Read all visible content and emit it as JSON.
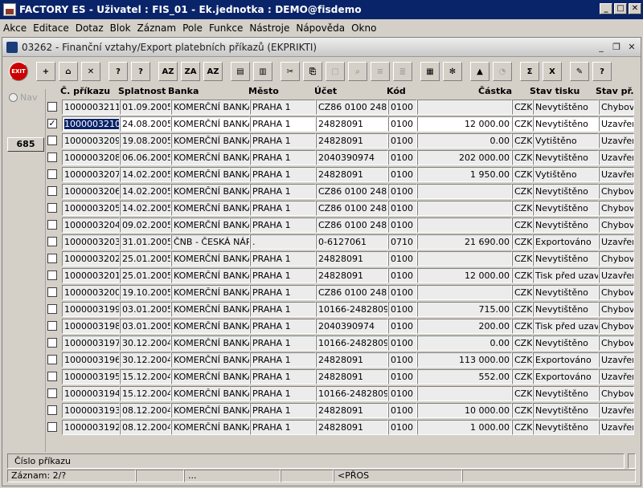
{
  "window": {
    "title": "FACTORY ES - Uživatel : FIS_01 - Ek.jednotka : DEMO@fisdemo"
  },
  "menu": [
    "Akce",
    "Editace",
    "Dotaz",
    "Blok",
    "Záznam",
    "Pole",
    "Funkce",
    "Nástroje",
    "Nápověda",
    "Okno"
  ],
  "form": {
    "title": "03262 - Finanční vztahy/Export platebních příkazů (EKPRIKTI)"
  },
  "toolbar": [
    {
      "name": "exit-button",
      "label": "EXIT",
      "enabled": true
    },
    {
      "name": "insert-record-button",
      "label": "+",
      "enabled": true
    },
    {
      "name": "save-button",
      "label": "⌂",
      "enabled": true
    },
    {
      "name": "delete-record-button",
      "label": "✕",
      "enabled": true
    },
    {
      "name": "query-button",
      "label": "?",
      "enabled": true
    },
    {
      "name": "execute-query-button",
      "label": "?",
      "enabled": true
    },
    {
      "name": "sort-asc-button",
      "label": "AZ",
      "enabled": true
    },
    {
      "name": "sort-desc-button",
      "label": "ZA",
      "enabled": true
    },
    {
      "name": "sort-multi-button",
      "label": "AZ",
      "enabled": true
    },
    {
      "name": "print-button",
      "label": "▤",
      "enabled": true
    },
    {
      "name": "print-preview-button",
      "label": "▥",
      "enabled": true
    },
    {
      "name": "cut-button",
      "label": "✂",
      "enabled": true
    },
    {
      "name": "copy-button",
      "label": "⎘",
      "enabled": true
    },
    {
      "name": "paste-button",
      "label": "▢",
      "enabled": false
    },
    {
      "name": "find-button",
      "label": "⌕",
      "enabled": false
    },
    {
      "name": "list-button",
      "label": "≡",
      "enabled": false
    },
    {
      "name": "list2-button",
      "label": "≣",
      "enabled": false
    },
    {
      "name": "calculator-button",
      "label": "▦",
      "enabled": true
    },
    {
      "name": "settings-button",
      "label": "✻",
      "enabled": true
    },
    {
      "name": "triangle-button",
      "label": "▲",
      "enabled": true
    },
    {
      "name": "calendar-button",
      "label": "◔",
      "enabled": false
    },
    {
      "name": "sum-button",
      "label": "Σ",
      "enabled": true
    },
    {
      "name": "excel-button",
      "label": "X",
      "enabled": true
    },
    {
      "name": "edit-form-button",
      "label": "✎",
      "enabled": true
    },
    {
      "name": "help-button",
      "label": "?",
      "enabled": true
    }
  ],
  "nav": {
    "label": "Nav",
    "count": "685"
  },
  "columns": [
    "Č. příkazu",
    "Splatnost",
    "Banka",
    "Město",
    "Účet",
    "Kód",
    "Částka",
    "Stav tisku",
    "Stav př."
  ],
  "rows": [
    {
      "checked": false,
      "cislo": "1000003211",
      "splatnost": "01.09.2005",
      "banka": "KOMERČNÍ BANKA",
      "mesto": "PRAHA 1",
      "ucet": "CZ86 0100 2482 0",
      "kod": "0100",
      "castka": "",
      "mena": "CZK",
      "stav_tisku": "Nevytištěno",
      "stav_pr": "Chybový"
    },
    {
      "checked": true,
      "cislo": "1000003210",
      "splatnost": "24.08.2005",
      "banka": "KOMERČNÍ BANKA",
      "mesto": "PRAHA 1",
      "ucet": "24828091",
      "kod": "0100",
      "castka": "12 000.00",
      "mena": "CZK",
      "stav_tisku": "Nevytištěno",
      "stav_pr": "Uzavřen"
    },
    {
      "checked": false,
      "cislo": "1000003209",
      "splatnost": "19.08.2005",
      "banka": "KOMERČNÍ BANKA",
      "mesto": "PRAHA 1",
      "ucet": "24828091",
      "kod": "0100",
      "castka": "0.00",
      "mena": "CZK",
      "stav_tisku": "Vytištěno",
      "stav_pr": "Uzavřen"
    },
    {
      "checked": false,
      "cislo": "1000003208",
      "splatnost": "06.06.2005",
      "banka": "KOMERČNÍ BANKA",
      "mesto": "PRAHA 1",
      "ucet": "2040390974",
      "kod": "0100",
      "castka": "202 000.00",
      "mena": "CZK",
      "stav_tisku": "Nevytištěno",
      "stav_pr": "Uzavřen"
    },
    {
      "checked": false,
      "cislo": "1000003207",
      "splatnost": "14.02.2005",
      "banka": "KOMERČNÍ BANKA",
      "mesto": "PRAHA 1",
      "ucet": "24828091",
      "kod": "0100",
      "castka": "1 950.00",
      "mena": "CZK",
      "stav_tisku": "Vytištěno",
      "stav_pr": "Uzavřen"
    },
    {
      "checked": false,
      "cislo": "1000003206",
      "splatnost": "14.02.2005",
      "banka": "KOMERČNÍ BANKA",
      "mesto": "PRAHA 1",
      "ucet": "CZ86 0100 2482 0",
      "kod": "0100",
      "castka": "",
      "mena": "CZK",
      "stav_tisku": "Nevytištěno",
      "stav_pr": "Chybový"
    },
    {
      "checked": false,
      "cislo": "1000003205",
      "splatnost": "14.02.2005",
      "banka": "KOMERČNÍ BANKA",
      "mesto": "PRAHA 1",
      "ucet": "CZ86 0100 2482 0",
      "kod": "0100",
      "castka": "",
      "mena": "CZK",
      "stav_tisku": "Nevytištěno",
      "stav_pr": "Chybový"
    },
    {
      "checked": false,
      "cislo": "1000003204",
      "splatnost": "09.02.2005",
      "banka": "KOMERČNÍ BANKA",
      "mesto": "PRAHA 1",
      "ucet": "CZ86 0100 2482 0",
      "kod": "0100",
      "castka": "",
      "mena": "CZK",
      "stav_tisku": "Nevytištěno",
      "stav_pr": "Chybový"
    },
    {
      "checked": false,
      "cislo": "1000003203",
      "splatnost": "31.01.2005",
      "banka": "ČNB - ČESKÁ NÁRO",
      "mesto": ".",
      "ucet": "0-6127061",
      "kod": "0710",
      "castka": "21 690.00",
      "mena": "CZK",
      "stav_tisku": "Exportováno",
      "stav_pr": "Uzavřen"
    },
    {
      "checked": false,
      "cislo": "1000003202",
      "splatnost": "25.01.2005",
      "banka": "KOMERČNÍ BANKA",
      "mesto": "PRAHA 1",
      "ucet": "24828091",
      "kod": "0100",
      "castka": "",
      "mena": "CZK",
      "stav_tisku": "Nevytištěno",
      "stav_pr": "Chybový"
    },
    {
      "checked": false,
      "cislo": "1000003201",
      "splatnost": "25.01.2005",
      "banka": "KOMERČNÍ BANKA",
      "mesto": "PRAHA 1",
      "ucet": "24828091",
      "kod": "0100",
      "castka": "12 000.00",
      "mena": "CZK",
      "stav_tisku": "Tisk před uzavř.",
      "stav_pr": "Uzavřen"
    },
    {
      "checked": false,
      "cislo": "1000003200",
      "splatnost": "19.10.2005",
      "banka": "KOMERČNÍ BANKA",
      "mesto": "PRAHA 1",
      "ucet": "CZ86 0100 2482 0",
      "kod": "0100",
      "castka": "",
      "mena": "CZK",
      "stav_tisku": "Nevytištěno",
      "stav_pr": "Chybový"
    },
    {
      "checked": false,
      "cislo": "1000003199",
      "splatnost": "03.01.2005",
      "banka": "KOMERČNÍ BANKA",
      "mesto": "PRAHA 1",
      "ucet": "10166-24828091",
      "kod": "0100",
      "castka": "715.00",
      "mena": "CZK",
      "stav_tisku": "Nevytištěno",
      "stav_pr": "Chybový"
    },
    {
      "checked": false,
      "cislo": "1000003198",
      "splatnost": "03.01.2005",
      "banka": "KOMERČNÍ BANKA",
      "mesto": "PRAHA 1",
      "ucet": "2040390974",
      "kod": "0100",
      "castka": "200.00",
      "mena": "CZK",
      "stav_tisku": "Tisk před uzavř.",
      "stav_pr": "Chybový"
    },
    {
      "checked": false,
      "cislo": "1000003197",
      "splatnost": "30.12.2004",
      "banka": "KOMERČNÍ BANKA",
      "mesto": "PRAHA 1",
      "ucet": "10166-24828091",
      "kod": "0100",
      "castka": "0.00",
      "mena": "CZK",
      "stav_tisku": "Nevytištěno",
      "stav_pr": "Chybový"
    },
    {
      "checked": false,
      "cislo": "1000003196",
      "splatnost": "30.12.2004",
      "banka": "KOMERČNÍ BANKA",
      "mesto": "PRAHA 1",
      "ucet": "24828091",
      "kod": "0100",
      "castka": "113 000.00",
      "mena": "CZK",
      "stav_tisku": "Exportováno",
      "stav_pr": "Uzavřen"
    },
    {
      "checked": false,
      "cislo": "1000003195",
      "splatnost": "15.12.2004",
      "banka": "KOMERČNÍ BANKA",
      "mesto": "PRAHA 1",
      "ucet": "24828091",
      "kod": "0100",
      "castka": "552.00",
      "mena": "CZK",
      "stav_tisku": "Exportováno",
      "stav_pr": "Uzavřen"
    },
    {
      "checked": false,
      "cislo": "1000003194",
      "splatnost": "15.12.2004",
      "banka": "KOMERČNÍ BANKA",
      "mesto": "PRAHA 1",
      "ucet": "10166-24828091",
      "kod": "0100",
      "castka": "",
      "mena": "CZK",
      "stav_tisku": "Nevytištěno",
      "stav_pr": "Chybový"
    },
    {
      "checked": false,
      "cislo": "1000003193",
      "splatnost": "08.12.2004",
      "banka": "KOMERČNÍ BANKA",
      "mesto": "PRAHA 1",
      "ucet": "24828091",
      "kod": "0100",
      "castka": "10 000.00",
      "mena": "CZK",
      "stav_tisku": "Nevytištěno",
      "stav_pr": "Uzavřen"
    },
    {
      "checked": false,
      "cislo": "1000003192",
      "splatnost": "08.12.2004",
      "banka": "KOMERČNÍ BANKA",
      "mesto": "PRAHA 1",
      "ucet": "24828091",
      "kod": "0100",
      "castka": "1 000.00",
      "mena": "CZK",
      "stav_tisku": "Nevytištěno",
      "stav_pr": "Uzavřen"
    }
  ],
  "status": {
    "field_hint": "Číslo příkazu",
    "record": "Záznam: 2/?",
    "seg2": "",
    "seg3": "...",
    "seg4": "",
    "seg5": "<PŘOS",
    "seg6": ""
  },
  "colors": {
    "titlebar": "#0a246a",
    "selection": "#0a246a",
    "window": "#d4d0c8"
  }
}
